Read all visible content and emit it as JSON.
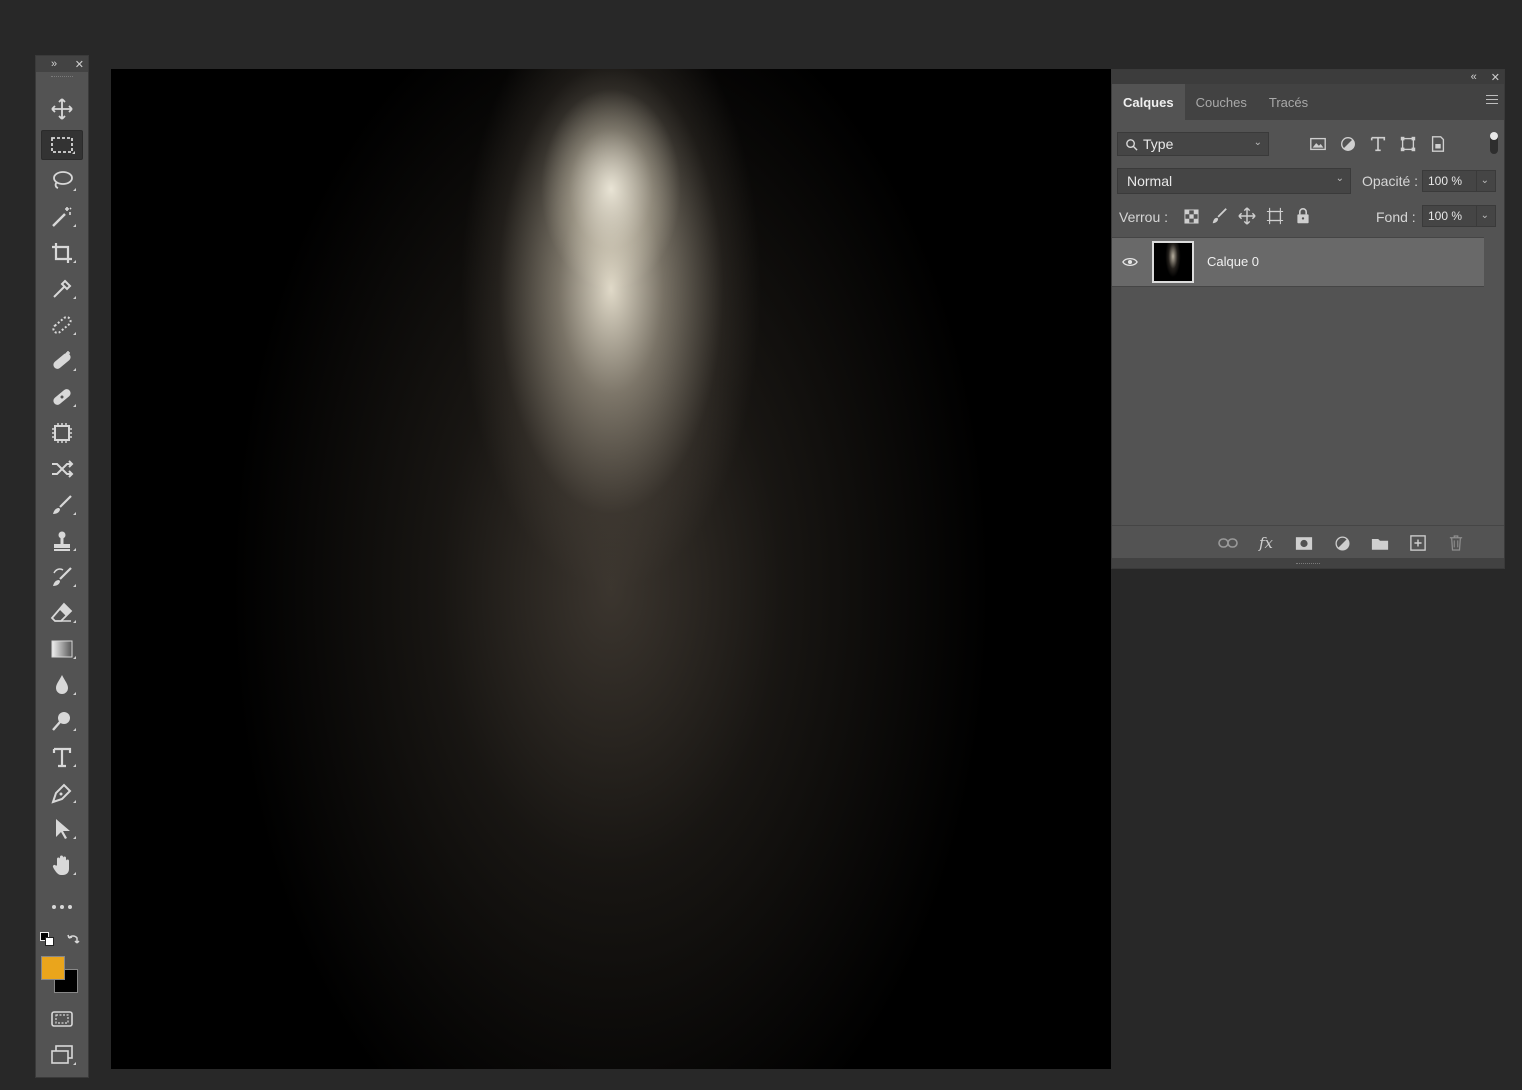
{
  "toolbar": {
    "expand_glyph": "»",
    "close_glyph": "✕",
    "tools": [
      {
        "name": "move-tool",
        "icon": "move-icon",
        "active": false
      },
      {
        "name": "rectangular-marquee-tool",
        "icon": "marquee-icon",
        "active": true
      },
      {
        "name": "lasso-tool",
        "icon": "lasso-icon",
        "active": false
      },
      {
        "name": "magic-wand-tool",
        "icon": "magic-wand-icon",
        "active": false
      },
      {
        "name": "crop-tool",
        "icon": "crop-icon",
        "active": false
      },
      {
        "name": "eyedropper-tool",
        "icon": "eyedropper-icon",
        "active": false
      },
      {
        "name": "spot-healing-tool",
        "icon": "spot-healing-icon",
        "active": false
      },
      {
        "name": "healing-brush-tool",
        "icon": "healing-brush-icon",
        "active": false
      },
      {
        "name": "patch-tool",
        "icon": "bandage-icon",
        "active": false
      },
      {
        "name": "content-aware-tool",
        "icon": "chip-icon",
        "active": false
      },
      {
        "name": "red-eye-tool",
        "icon": "crossed-arrows-icon",
        "active": false
      },
      {
        "name": "brush-tool",
        "icon": "brush-icon",
        "active": false
      },
      {
        "name": "clone-stamp-tool",
        "icon": "stamp-icon",
        "active": false
      },
      {
        "name": "history-brush-tool",
        "icon": "history-brush-icon",
        "active": false
      },
      {
        "name": "eraser-tool",
        "icon": "eraser-icon",
        "active": false
      },
      {
        "name": "gradient-tool",
        "icon": "gradient-icon",
        "active": false
      },
      {
        "name": "blur-tool",
        "icon": "drop-icon",
        "active": false
      },
      {
        "name": "dodge-tool",
        "icon": "dodge-icon",
        "active": false
      },
      {
        "name": "type-tool",
        "icon": "type-icon",
        "active": false
      },
      {
        "name": "pen-tool",
        "icon": "pen-icon",
        "active": false
      },
      {
        "name": "path-selection-tool",
        "icon": "arrow-icon",
        "active": false
      },
      {
        "name": "hand-tool",
        "icon": "hand-icon",
        "active": false
      },
      {
        "name": "edit-toolbar",
        "icon": "more-icon",
        "active": false
      }
    ],
    "foreground_color": "#eaa51c",
    "background_color": "#000000"
  },
  "canvas": {
    "description_colors": {
      "base": "#000000",
      "light": "#ebe4d2"
    }
  },
  "layers_panel": {
    "collapse_glyph": "«",
    "close_glyph": "✕",
    "tabs": [
      {
        "label": "Calques",
        "active": true
      },
      {
        "label": "Couches",
        "active": false
      },
      {
        "label": "Tracés",
        "active": false
      }
    ],
    "filter": {
      "value": "Type"
    },
    "blend_mode": "Normal",
    "opacity_label": "Opacité :",
    "opacity_value": "100 %",
    "lock_label": "Verrou :",
    "fill_label": "Fond :",
    "fill_value": "100 %",
    "layers": [
      {
        "name": "Calque 0",
        "visible": true
      }
    ]
  }
}
